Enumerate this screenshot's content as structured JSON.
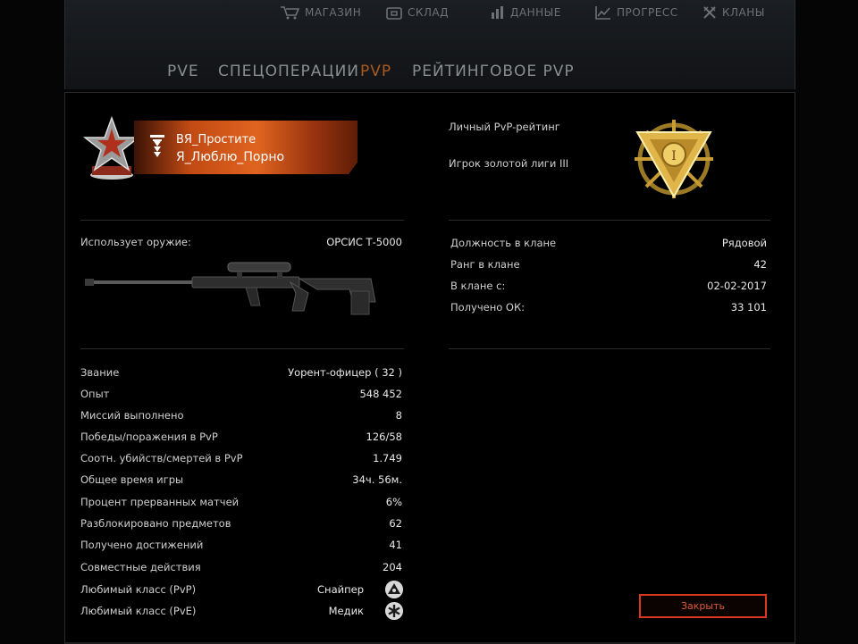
{
  "top_nav": [
    {
      "label": "МАГАЗИН",
      "icon": "cart-icon"
    },
    {
      "label": "СКЛАД",
      "icon": "warehouse-icon"
    },
    {
      "label": "ДАННЫЕ",
      "icon": "data-icon"
    },
    {
      "label": "ПРОГРЕСС",
      "icon": "progress-chart-icon"
    },
    {
      "label": "КЛАНЫ",
      "icon": "clans-icon"
    }
  ],
  "modes": [
    {
      "label": "PVE",
      "active": false
    },
    {
      "label": "СПЕЦОПЕРАЦИИ",
      "active": false
    },
    {
      "label": "PVP",
      "active": true
    },
    {
      "label": "РЕЙТИНГОВОЕ PVP",
      "active": false
    }
  ],
  "profile": {
    "clan_name": "ВЯ_Простите",
    "nickname": "Я_Люблю_Порно",
    "pvp_rating_label": "Личный PvP-рейтинг",
    "league_label": "Игрок золотой лиги III",
    "league_numeral": "I"
  },
  "weapon": {
    "label": "Использует оружие:",
    "name": "ОРСИС Т-5000"
  },
  "clan_info": [
    {
      "label": "Должность в клане",
      "value": "Рядовой"
    },
    {
      "label": "Ранг в клане",
      "value": "42"
    },
    {
      "label": "В клане с:",
      "value": "02-02-2017"
    },
    {
      "label": "Получено ОК:",
      "value": "33 101"
    }
  ],
  "stats": [
    {
      "label": "Звание",
      "value": "Уорент-офицер ( 32 )"
    },
    {
      "label": "Опыт",
      "value": "548 452"
    },
    {
      "label": "Миссий выполнено",
      "value": "8"
    },
    {
      "label": "Победы/поражения в PvP",
      "value": "126/58"
    },
    {
      "label": "Соотн. убийств/смертей в PvP",
      "value": "1.749"
    },
    {
      "label": "Общее время игры",
      "value": "34ч. 56м."
    },
    {
      "label": "Процент прерванных матчей",
      "value": "6%"
    },
    {
      "label": "Разблокировано предметов",
      "value": "62"
    },
    {
      "label": "Получено достижений",
      "value": "41"
    },
    {
      "label": "Совместные действия",
      "value": "204"
    },
    {
      "label": "Любимый класс (PvP)",
      "value": "Снайпер",
      "icon": "sniper-class-icon"
    },
    {
      "label": "Любимый класс (PvE)",
      "value": "Медик",
      "icon": "medic-class-icon"
    }
  ],
  "close_button": "Закрыть",
  "colors": {
    "accent_active": "#a85a1f",
    "banner": "#e0641f",
    "close_border": "#d9381e",
    "league_gold": "#d4a63a"
  }
}
